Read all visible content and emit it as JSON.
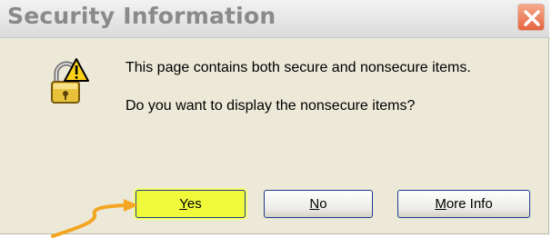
{
  "dialog": {
    "title": "Security Information",
    "close_icon": "close-icon",
    "warning_icon": "security-warning-icon",
    "message_line1": "This page contains both secure and nonsecure items.",
    "message_line2": "Do you want to display the nonsecure items?"
  },
  "buttons": {
    "yes": {
      "access_key": "Y",
      "rest": "es"
    },
    "no": {
      "access_key": "N",
      "rest": "o"
    },
    "more_info": {
      "access_key": "M",
      "rest": "ore Info"
    }
  },
  "annotation": {
    "arrow_color": "#f4a623",
    "highlight_color": "#f0fa3a"
  }
}
